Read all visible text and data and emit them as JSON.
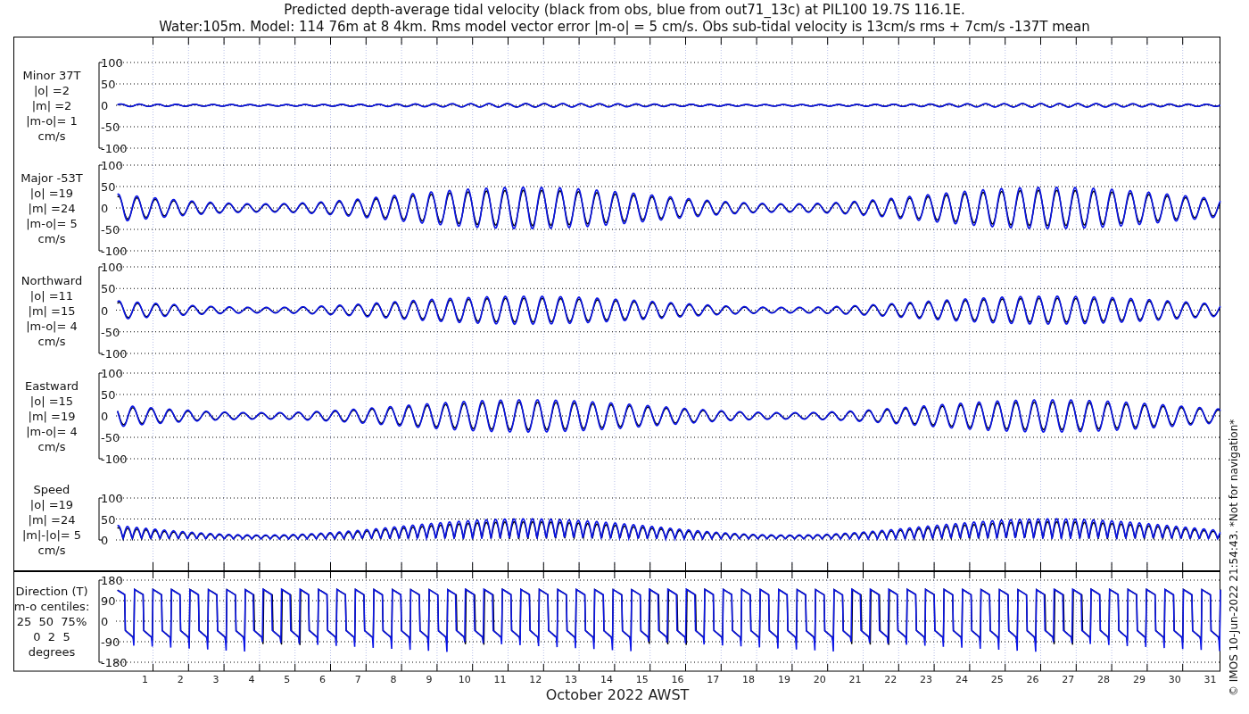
{
  "figure": {
    "title_lines": [
      "Predicted depth-average tidal velocity (black from obs, blue from out71_13c) at PIL100 19.7S 116.1E.",
      "Water:105m. Model: 114 76m at 8 4km. Rms model vector error |m-o| = 5 cm/s. Obs sub-tidal velocity is 13cm/s rms + 7cm/s -137T mean"
    ],
    "panels": [
      {
        "kind": "minor",
        "label_lines": [
          "Minor 37T",
          "|o| =2",
          "|m| =2",
          "|m-o|= 1",
          "cm/s"
        ],
        "yticks": [
          "100",
          "50",
          "0",
          "-50",
          "-100"
        ]
      },
      {
        "kind": "wave",
        "label_lines": [
          "Major -53T",
          "|o| =19",
          "|m| =24",
          "|m-o|= 5",
          "cm/s"
        ],
        "yticks": [
          "100",
          "50",
          "0",
          "-50",
          "-100"
        ]
      },
      {
        "kind": "wave",
        "label_lines": [
          "Northward",
          "|o| =11",
          "|m| =15",
          "|m-o|= 4",
          "cm/s"
        ],
        "yticks": [
          "100",
          "50",
          "0",
          "-50",
          "-100"
        ]
      },
      {
        "kind": "wave",
        "label_lines": [
          "Eastward",
          "|o| =15",
          "|m| =19",
          "|m-o|= 4",
          "cm/s"
        ],
        "yticks": [
          "100",
          "50",
          "0",
          "-50",
          "-100"
        ]
      },
      {
        "kind": "speed",
        "label_lines": [
          "Speed",
          "|o| =19",
          "|m| =24",
          "|m|-|o|= 5",
          "cm/s"
        ],
        "yticks": [
          "100",
          "50",
          "0"
        ]
      },
      {
        "kind": "direction",
        "label_lines": [
          "Direction (T)",
          "m-o centiles:",
          "25  50  75%",
          "0  2  5",
          "degrees"
        ],
        "yticks": [
          "180",
          "90",
          "0",
          "-90",
          "-180"
        ]
      }
    ],
    "x_tick_labels": [
      "1",
      "2",
      "3",
      "4",
      "5",
      "6",
      "7",
      "8",
      "9",
      "10",
      "11",
      "12",
      "13",
      "14",
      "15",
      "16",
      "17",
      "18",
      "19",
      "20",
      "21",
      "22",
      "23",
      "24",
      "25",
      "26",
      "27",
      "28",
      "29",
      "30",
      "31"
    ],
    "xlabel": "October 2022 AWST",
    "credit": "© IMOS 10-Jun-2022 21:54:43. *Not for navigation*"
  }
}
